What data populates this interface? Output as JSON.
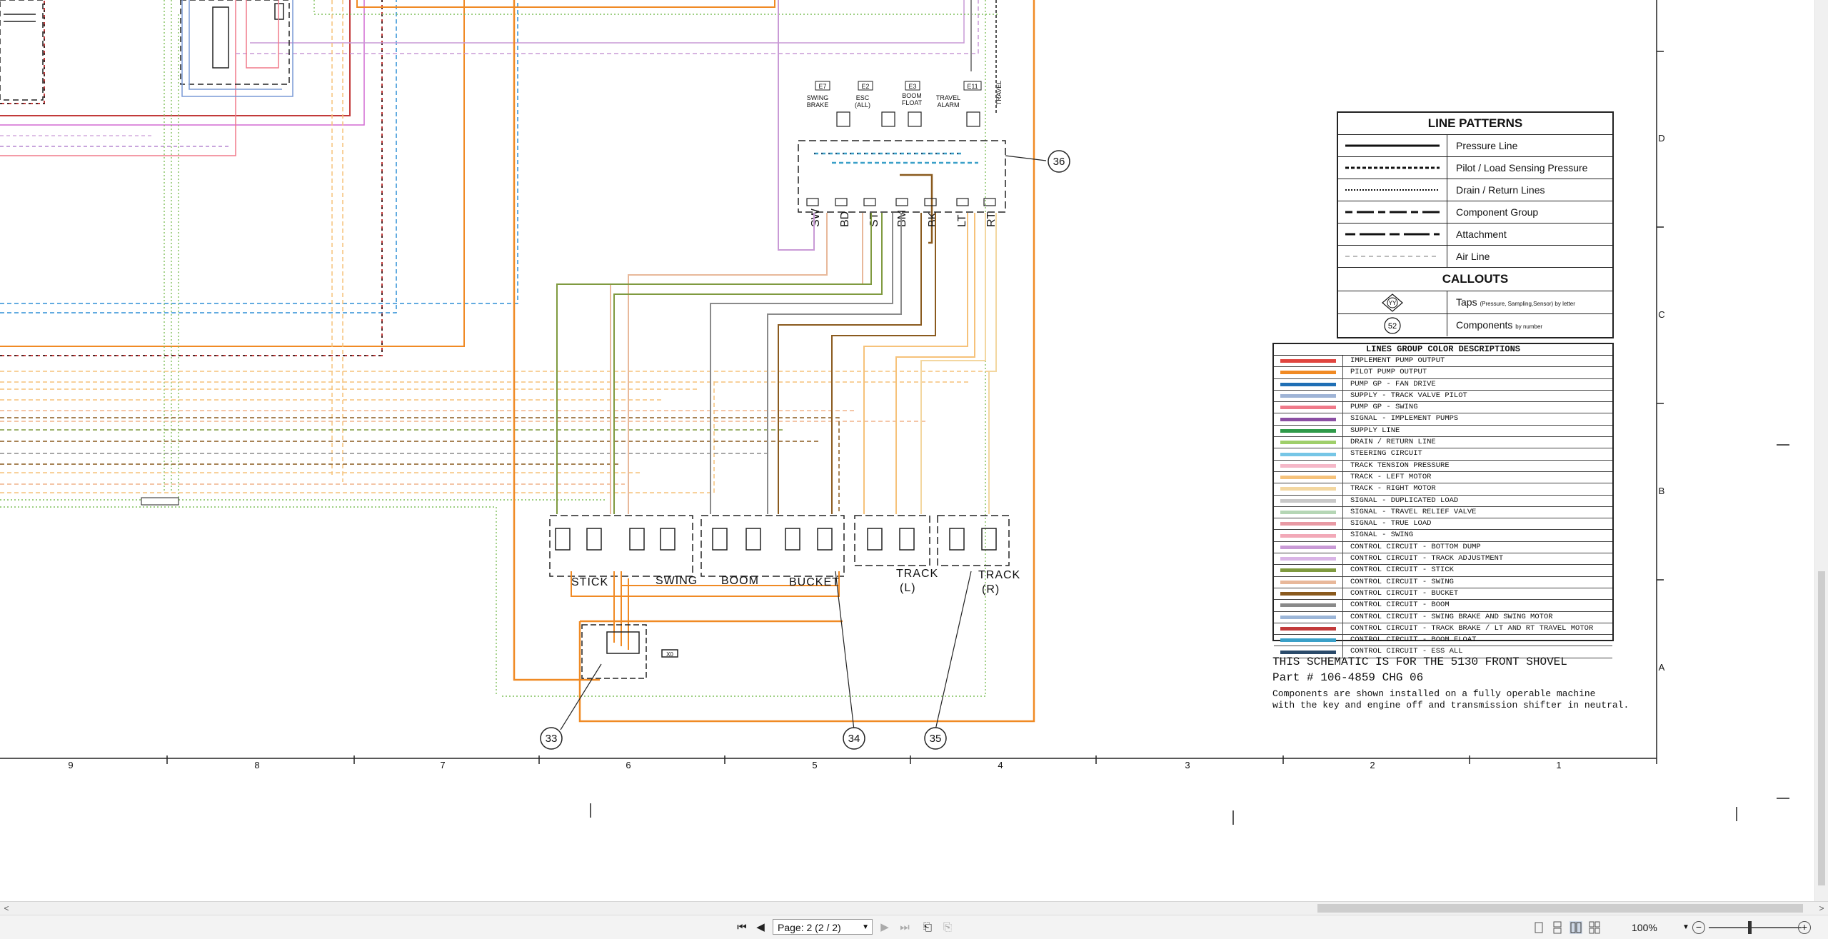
{
  "diagram": {
    "zone_letters": [
      "D",
      "C",
      "B",
      "A"
    ],
    "column_numbers": [
      "9",
      "8",
      "7",
      "6",
      "5",
      "4",
      "3",
      "2",
      "1"
    ],
    "group_labels": [
      "STICK",
      "SWING",
      "BOOM",
      "BUCKET",
      "TRACK",
      "(L)",
      "TRACK",
      "(R)"
    ],
    "callouts": [
      "33",
      "34",
      "35",
      "36"
    ],
    "taps": [
      {
        "id": "E7",
        "label_lines": [
          "SWING",
          "BRAKE"
        ]
      },
      {
        "id": "E2",
        "label_lines": [
          "ESC",
          "(ALL)"
        ]
      },
      {
        "id": "E3",
        "label_lines": [
          "BOOM",
          "FLOAT"
        ]
      },
      {
        "id": "E11",
        "label_lines": [
          "TRAVEL",
          "ALARM"
        ]
      }
    ],
    "travel_label": "TRAVEL",
    "valve_labels": [
      "SW",
      "BD",
      "ST",
      "BM",
      "BK",
      "LT",
      "RT"
    ],
    "port_label": "X0"
  },
  "line_patterns": {
    "title": "LINE PATTERNS",
    "rows": [
      {
        "label": "Pressure Line",
        "style": "solid"
      },
      {
        "label": "Pilot / Load Sensing Pressure",
        "style": "dashed"
      },
      {
        "label": "Drain / Return Lines",
        "style": "dotted"
      },
      {
        "label": "Component Group",
        "style": "longdash"
      },
      {
        "label": "Attachment",
        "style": "dashdot"
      },
      {
        "label": "Air Line",
        "style": "thin-dashed"
      }
    ],
    "callouts_title": "CALLOUTS",
    "callout_rows": [
      {
        "symbol": "YY",
        "label": "Taps",
        "small": "(Pressure, Sampling,Sensor) by letter"
      },
      {
        "symbol": "52",
        "label": "Components",
        "small": "by number"
      }
    ]
  },
  "color_descriptions": {
    "title": "LINES GROUP COLOR DESCRIPTIONS",
    "rows": [
      {
        "name": "IMPLEMENT PUMP OUTPUT",
        "color": "#e0453f"
      },
      {
        "name": "PILOT PUMP OUTPUT",
        "color": "#f08a24"
      },
      {
        "name": "PUMP GP - FAN DRIVE",
        "color": "#1f6fb5"
      },
      {
        "name": "SUPPLY - TRACK VALVE PILOT",
        "color": "#9fb4d6"
      },
      {
        "name": "PUMP GP - SWING",
        "color": "#f07a8a"
      },
      {
        "name": "SIGNAL - IMPLEMENT PUMPS",
        "color": "#8b4fa3"
      },
      {
        "name": "SUPPLY LINE",
        "color": "#2f9a4a"
      },
      {
        "name": "DRAIN / RETURN LINE",
        "color": "#9fcf6a"
      },
      {
        "name": "STEERING CIRCUIT",
        "color": "#76c6e6"
      },
      {
        "name": "TRACK TENSION PRESSURE",
        "color": "#f5b8c8"
      },
      {
        "name": "TRACK - LEFT MOTOR",
        "color": "#f6c27a"
      },
      {
        "name": "TRACK - RIGHT MOTOR",
        "color": "#f3d7a0"
      },
      {
        "name": "SIGNAL - DUPLICATED LOAD",
        "color": "#c8c8c8"
      },
      {
        "name": "SIGNAL - TRAVEL RELIEF VALVE",
        "color": "#b5d6b5"
      },
      {
        "name": "SIGNAL - TRUE LOAD",
        "color": "#e89aa4"
      },
      {
        "name": "SIGNAL - SWING",
        "color": "#f2a9b8"
      },
      {
        "name": "CONTROL CIRCUIT - BOTTOM DUMP",
        "color": "#c99ad6"
      },
      {
        "name": "CONTROL CIRCUIT - TRACK ADJUSTMENT",
        "color": "#d9b4e6"
      },
      {
        "name": "CONTROL CIRCUIT - STICK",
        "color": "#7f9a3f"
      },
      {
        "name": "CONTROL CIRCUIT - SWING",
        "color": "#e8b89a"
      },
      {
        "name": "CONTROL CIRCUIT - BUCKET",
        "color": "#8a5a1e"
      },
      {
        "name": "CONTROL CIRCUIT - BOOM",
        "color": "#8a8a8a"
      },
      {
        "name": "CONTROL CIRCUIT - SWING BRAKE AND  SWING MOTOR",
        "color": "#9cb6d8"
      },
      {
        "name": "CONTROL CIRCUIT - TRACK BRAKE / LT AND RT TRAVEL MOTOR",
        "color": "#c23a3a"
      },
      {
        "name": "CONTROL CIRCUIT - BOOM FLOAT",
        "color": "#3aa0c8"
      },
      {
        "name": "CONTROL CIRCUIT - ESS ALL",
        "color": "#2a4a6a"
      }
    ]
  },
  "notes": {
    "line1": "THIS SCHEMATIC IS FOR THE 5130 FRONT SHOVEL",
    "line2": "Part # 106-4859 CHG 06",
    "line3": "Components are shown installed on a fully operable machine",
    "line4": "with the key and engine off and transmission shifter in neutral."
  },
  "viewer": {
    "page_field": "Page: 2 (2 / 2)",
    "zoom": "100%"
  }
}
